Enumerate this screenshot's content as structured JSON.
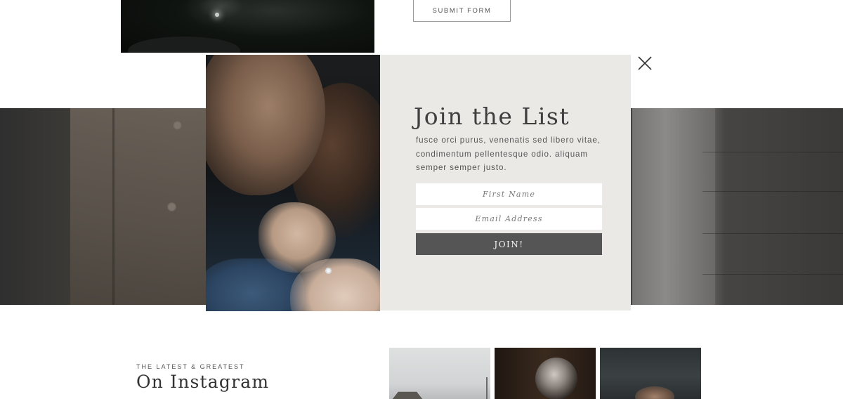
{
  "submit_form": {
    "label": "SUBMIT FORM"
  },
  "popup": {
    "title": "Join the List",
    "text": "fusce orci purus, venenatis sed libero vitae, condimentum pellentesque odio. aliquam semper semper justo.",
    "first_name_placeholder": "First Name",
    "email_placeholder": "Email Address",
    "join_label": "JOIN!",
    "close_icon": "close-x-icon"
  },
  "instagram": {
    "kicker": "THE LATEST & GREATEST",
    "title": "On Instagram"
  },
  "colors": {
    "panel_bg": "#ebe9e6",
    "button_bg": "#555555",
    "text_dark": "#3f3f3f"
  }
}
